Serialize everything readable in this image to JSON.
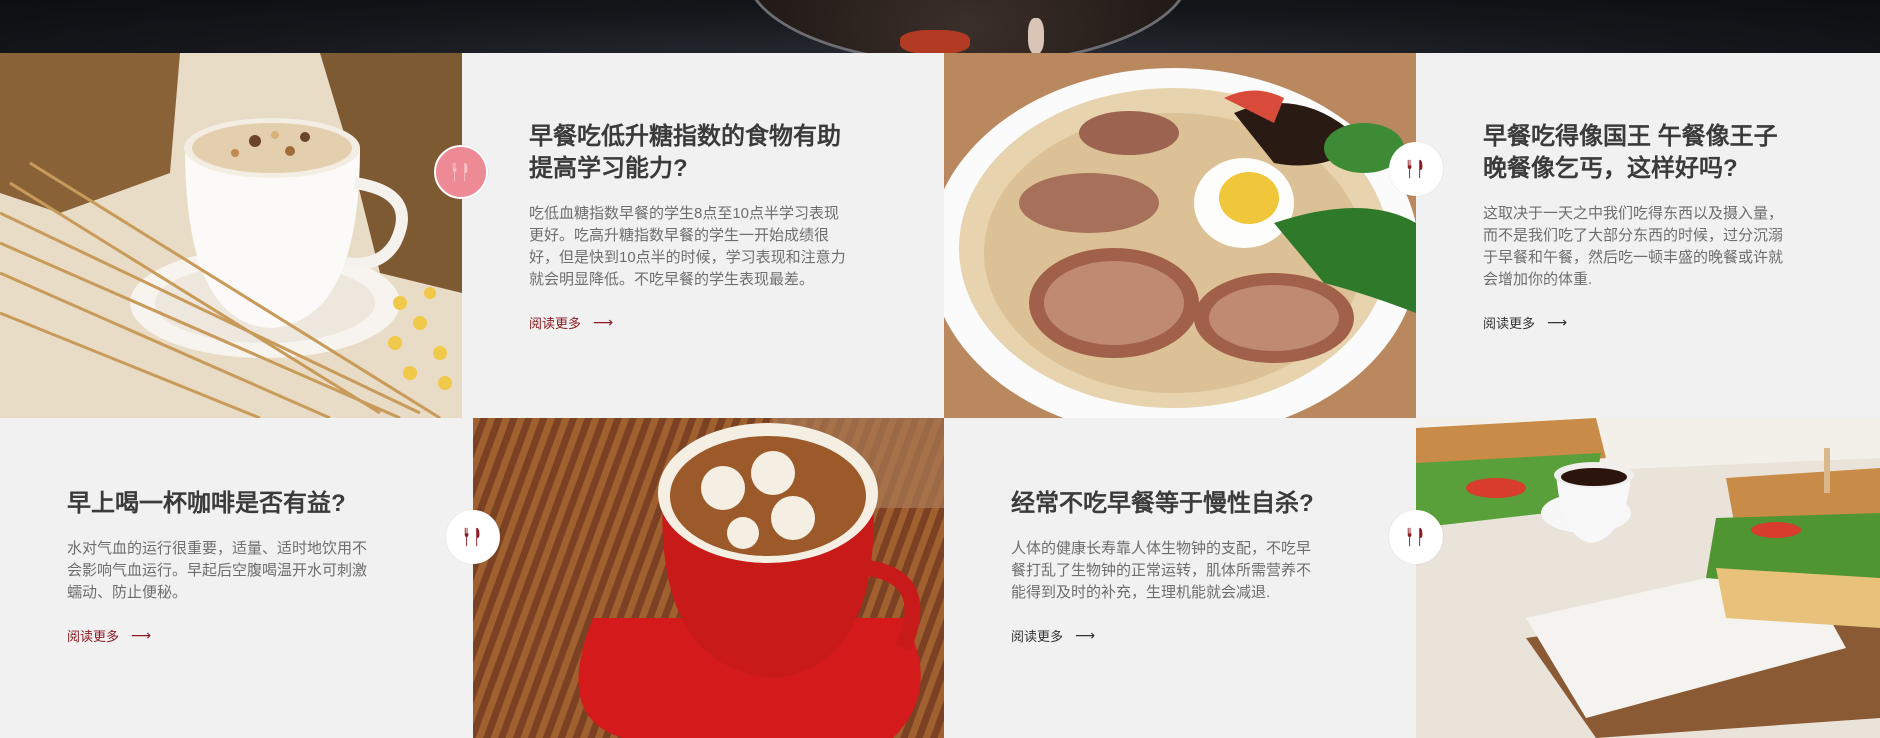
{
  "theme": {
    "accent": "#8b1c24",
    "badge_active_bg": "#ee8a94",
    "badge_active_border": "#ffffff",
    "text_dark": "#3b3b3b",
    "text_muted": "#6e6e6e",
    "panel_bg": "#f1f1f1"
  },
  "articles": [
    {
      "title_line1": "早餐吃低升糖指数的食物有助",
      "title_line2": "提高学习能力?",
      "body_lines": [
        "吃低血糖指数早餐的学生8点至10点半学习表现",
        "更好。吃高升糖指数早餐的学生一开始成绩很",
        "好，但是快到10点半的时候，学习表现和注意力",
        "就会明显降低。不吃早餐的学生表现最差。"
      ],
      "read_more": "阅读更多",
      "arrow": "⟶",
      "image_icon": "cereal-milk-cup-icon",
      "badge_icon": "utensils-icon"
    },
    {
      "title_line1": "早餐吃得像国王 午餐像王子",
      "title_line2": "晚餐像乞丐，这样好吗?",
      "body_lines": [
        "这取决于一天之中我们吃得东西以及摄入量，",
        "而不是我们吃了大部分东西的时候，过分沉溺",
        "于早餐和午餐，然后吃一顿丰盛的晚餐或许就",
        "会增加你的体重."
      ],
      "read_more": "阅读更多",
      "arrow": "⟶",
      "image_icon": "ramen-bowl-icon",
      "badge_icon": "utensils-icon"
    },
    {
      "title_line1": "早上喝一杯咖啡是否有益?",
      "body_lines": [
        "水对气血的运行很重要，适量、适时地饮用不",
        "会影响气血运行。早起后空腹喝温开水可刺激",
        "蠕动、防止便秘。"
      ],
      "read_more": "阅读更多",
      "arrow": "⟶",
      "image_icon": "latte-art-cup-icon",
      "badge_icon": "utensils-icon"
    },
    {
      "title_line1": "经常不吃早餐等于慢性自杀?",
      "body_lines": [
        "人体的健康长寿靠人体生物钟的支配，不吃早",
        "餐打乱了生物钟的正常运转，肌体所需营养不",
        "能得到及时的补充，生理机能就会减退."
      ],
      "read_more": "阅读更多",
      "arrow": "⟶",
      "image_icon": "sandwich-coffee-icon",
      "badge_icon": "utensils-icon"
    }
  ]
}
